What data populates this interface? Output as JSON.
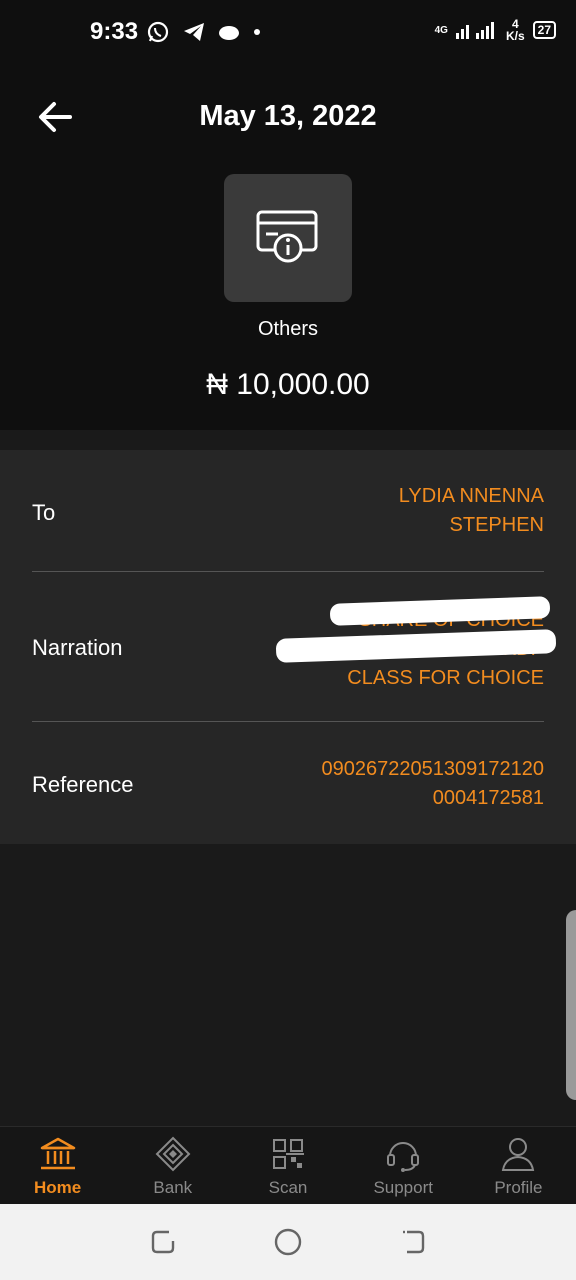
{
  "status_bar": {
    "time": "9:33",
    "network": "4G",
    "speed_value": "4",
    "speed_unit": "K/s",
    "battery": "27"
  },
  "header": {
    "title": "May 13, 2022",
    "category_label": "Others",
    "category_icon": "card-info-icon",
    "amount": "₦ 10,000.00"
  },
  "details": {
    "to": {
      "label": "To",
      "value_line1": "LYDIA NNENNA",
      "value_line2": "STEPHEN"
    },
    "narration": {
      "label": "Narration",
      "value_line1": "SHARE OF CHOICE",
      "value_line2": "AMAZON KDP",
      "value_line3": "CLASS FOR CHOICE"
    },
    "reference": {
      "label": "Reference",
      "value_line1": "0902672205130917212​0",
      "value_line2": "0004172581"
    }
  },
  "bottom_nav": {
    "items": [
      {
        "label": "Home",
        "icon": "bank-building-icon",
        "active": true
      },
      {
        "label": "Bank",
        "icon": "diamond-icon",
        "active": false
      },
      {
        "label": "Scan",
        "icon": "qr-code-icon",
        "active": false
      },
      {
        "label": "Support",
        "icon": "headset-icon",
        "active": false
      },
      {
        "label": "Profile",
        "icon": "person-icon",
        "active": false
      }
    ]
  },
  "colors": {
    "accent": "#f28c1f",
    "background": "#1a1a1a",
    "header_bg": "#0f0f0f",
    "card_bg": "#262626",
    "tile_bg": "#3a3a3a"
  }
}
